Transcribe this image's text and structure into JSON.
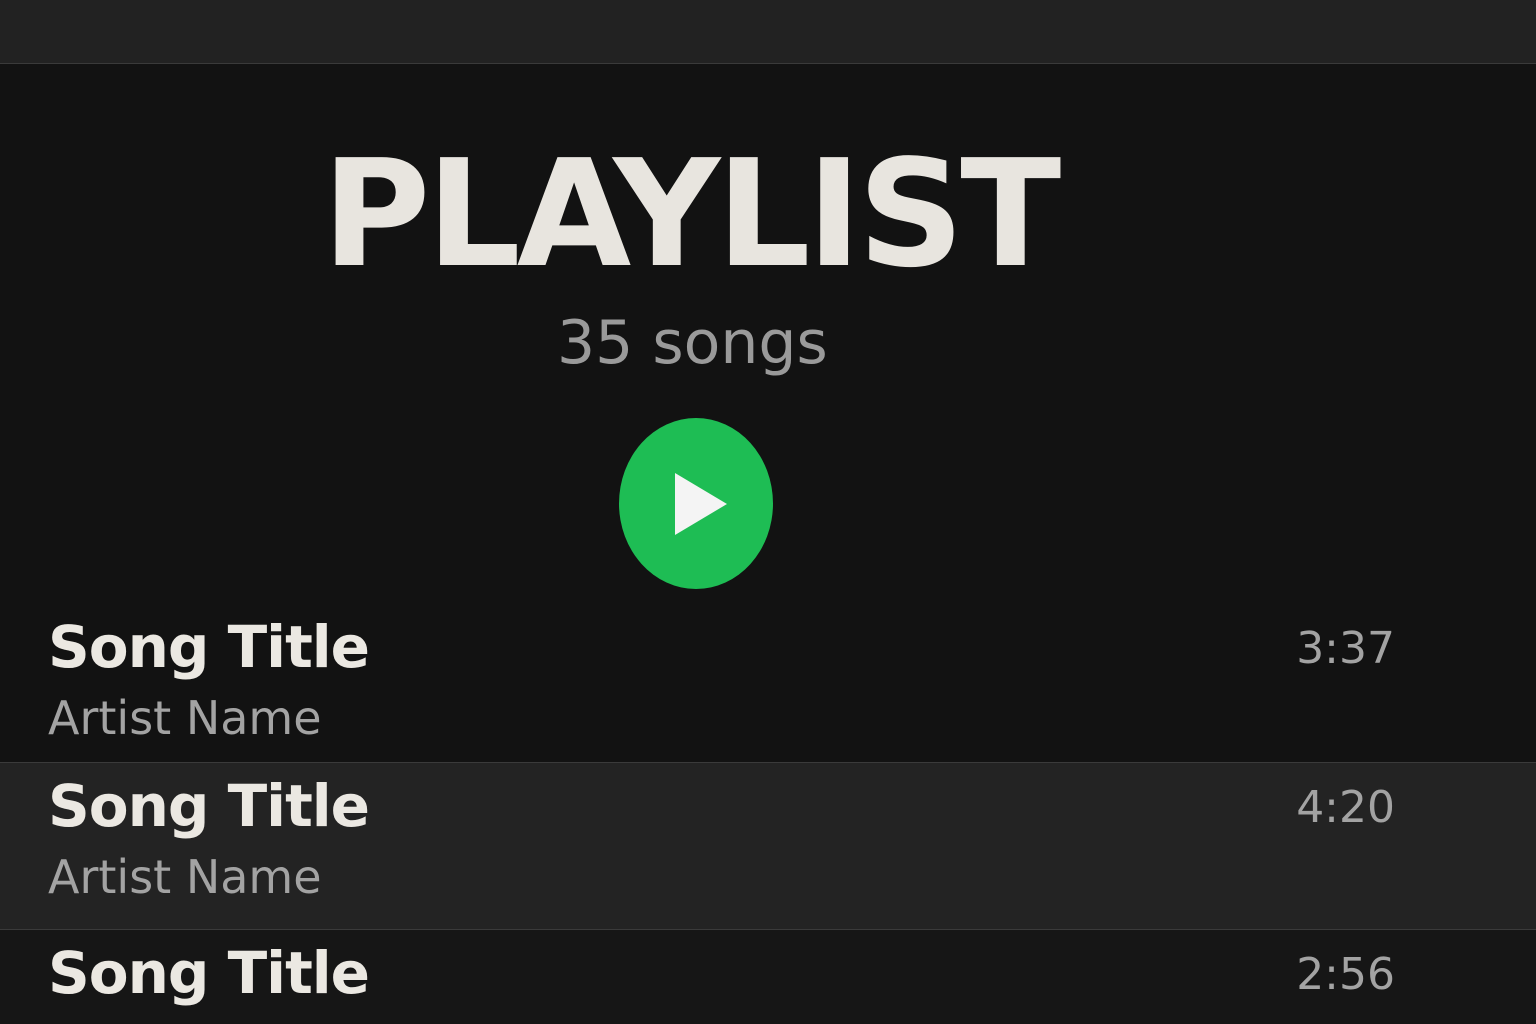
{
  "playlist": {
    "title": "PLAYLIST",
    "song_count": "35 songs",
    "play_icon": "play-icon",
    "accent_color": "#1ebd54"
  },
  "tracks": [
    {
      "title": "Song Title",
      "artist": "Artist Name",
      "duration": "3:37"
    },
    {
      "title": "Song Title",
      "artist": "Artist Name",
      "duration": "4:20"
    },
    {
      "title": "Song Title",
      "artist": "",
      "duration": "2:56"
    }
  ]
}
